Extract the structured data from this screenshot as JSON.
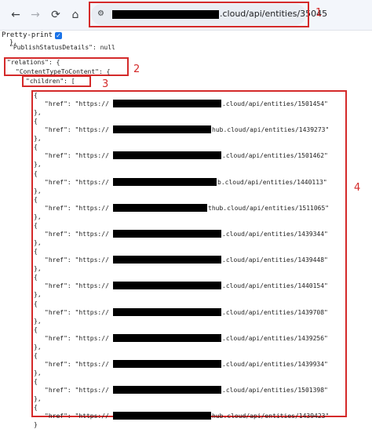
{
  "browser": {
    "back_icon": "←",
    "forward_icon": "→",
    "reload_icon": "⟳",
    "home_icon": "⌂",
    "site_icon": "⚙",
    "url_visible": ".cloud/api/entities/35045"
  },
  "annotations": [
    "1",
    "2",
    "3",
    "4"
  ],
  "toolbar": {
    "pretty_print_label": "Pretty-print",
    "pretty_print_checked": true
  },
  "json": {
    "top_brace": "},",
    "publish_line": "\"PublishStatusDetails\": null",
    "relations_line": "\"relations\": {",
    "content_line": "\"ContentTypeToContent\": {",
    "children_line": "\"children\": [",
    "row_key": "\"href\": \"https://",
    "open_brace": "{",
    "close_brace": "},",
    "last_close": "}"
  },
  "href_suffixes": [
    ".cloud/api/entities/1501454\"",
    "hub.cloud/api/entities/1439273\"",
    ".cloud/api/entities/1501462\"",
    "b.cloud/api/entities/1440113\"",
    "thub.cloud/api/entities/1511065\"",
    ".cloud/api/entities/1439344\"",
    ".cloud/api/entities/1439448\"",
    ".cloud/api/entities/1440154\"",
    ".cloud/api/entities/1439708\"",
    ".cloud/api/entities/1439256\"",
    ".cloud/api/entities/1439934\"",
    ".cloud/api/entities/1501398\"",
    "hub.cloud/api/entities/1439423\""
  ],
  "colors": {
    "annotation": "#d42a2a",
    "checkbox": "#1a73e8"
  }
}
